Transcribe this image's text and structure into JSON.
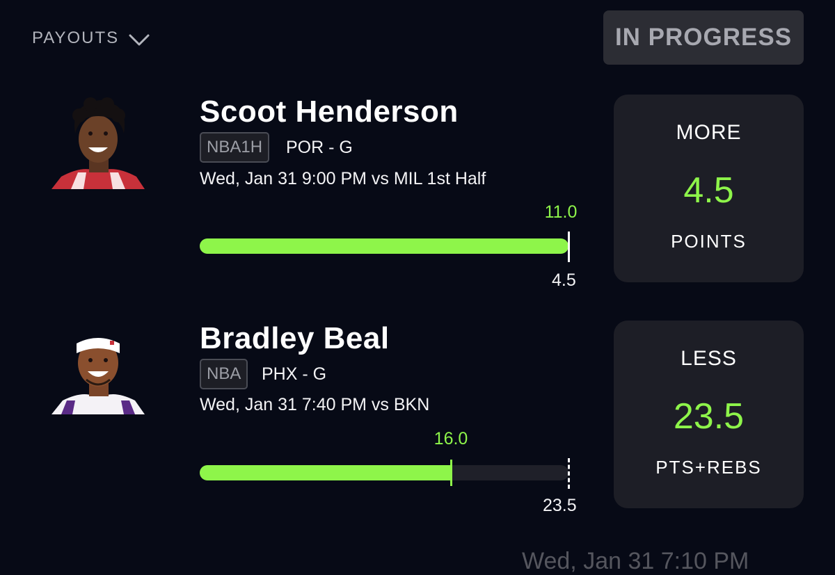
{
  "header": {
    "payouts_label": "PAYOUTS",
    "status": "IN PROGRESS"
  },
  "picks": [
    {
      "player": "Scoot Henderson",
      "league": "NBA1H",
      "team_pos": "POR - G",
      "game": "Wed, Jan 31 9:00 PM  vs MIL 1st Half",
      "current": "11.0",
      "current_value": 11.0,
      "line": "4.5",
      "line_value": 4.5,
      "progress_fraction": 1.0,
      "direction": "MORE",
      "projection": "4.5",
      "stat": "POINTS"
    },
    {
      "player": "Bradley Beal",
      "league": "NBA",
      "team_pos": "PHX - G",
      "game": "Wed, Jan 31 7:40 PM  vs BKN",
      "current": "16.0",
      "current_value": 16.0,
      "line": "23.5",
      "line_value": 23.5,
      "progress_fraction": 0.681,
      "direction": "LESS",
      "projection": "23.5",
      "stat": "PTS+REBS"
    }
  ],
  "footer_peek": "Wed, Jan 31 7:10 PM",
  "colors": {
    "background": "#070a16",
    "accent_green": "#8ef54a",
    "card": "#1d1e26",
    "status_badge": "#2c2d34"
  }
}
